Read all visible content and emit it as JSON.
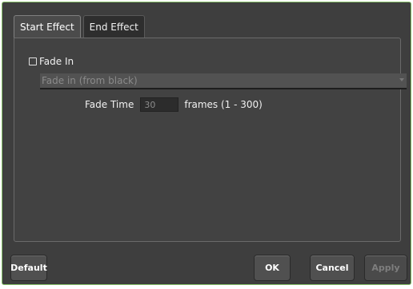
{
  "tabs": [
    {
      "label": "Start Effect",
      "active": true
    },
    {
      "label": "End Effect",
      "active": false
    }
  ],
  "fade": {
    "label": "Fade In",
    "checked": false
  },
  "dropdown": {
    "value": "Fade in (from black)"
  },
  "fade_time": {
    "label": "Fade Time",
    "value": "30",
    "units": "frames (1 - 300)"
  },
  "buttons": {
    "default_label": "Default",
    "ok_label": "OK",
    "cancel_label": "Cancel",
    "apply_label": "Apply",
    "apply_enabled": false
  },
  "colors": {
    "window_border": "#86c06a",
    "background": "#3e3e3e"
  }
}
